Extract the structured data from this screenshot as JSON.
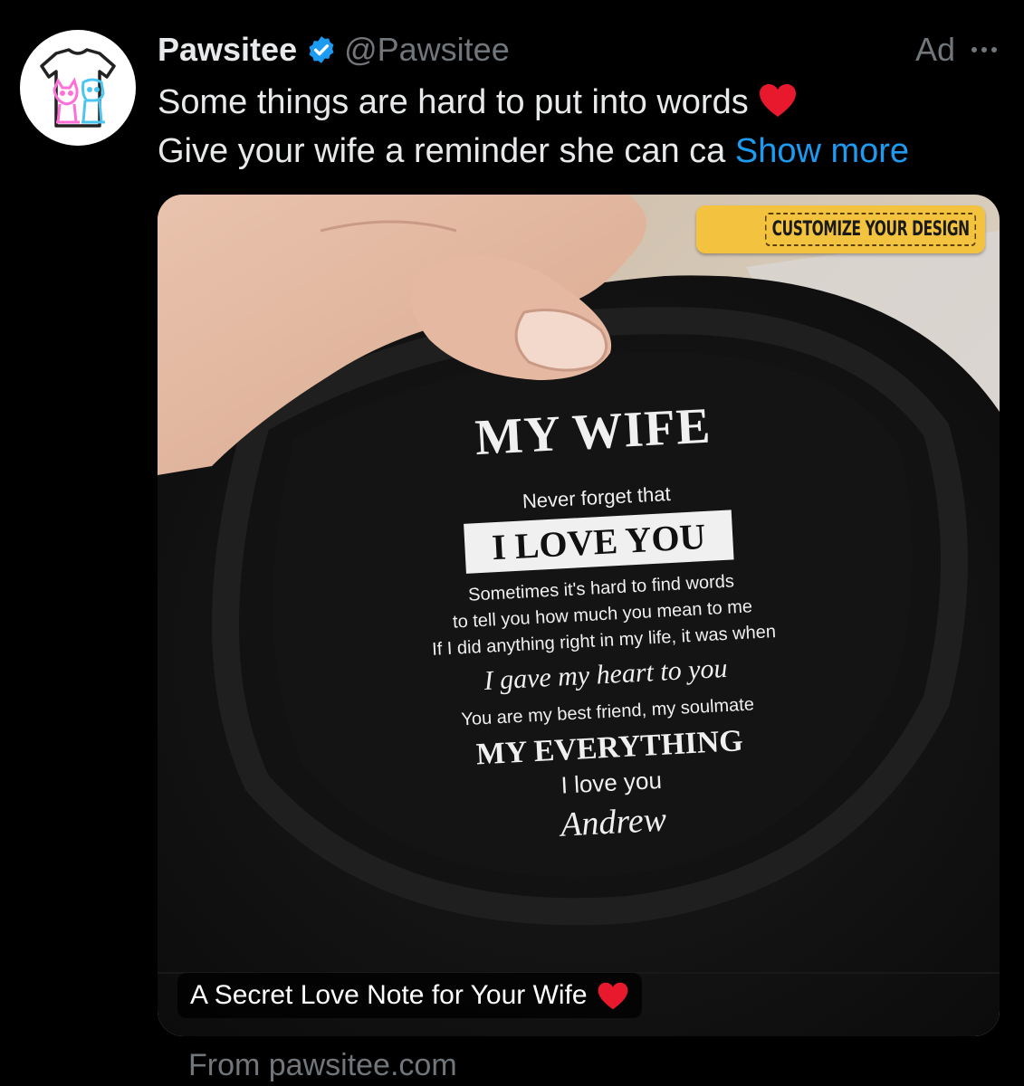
{
  "tweet": {
    "name": "Pawsitee",
    "handle": "@Pawsitee",
    "ad_label": "Ad",
    "line1": "Some things are hard to put into words",
    "line2": "Give your wife a reminder she can ca",
    "show_more": "Show more"
  },
  "media": {
    "badge": "CUSTOMIZE YOUR DESIGN",
    "caption": "A Secret Love Note for Your Wife",
    "print": {
      "title": "MY WIFE",
      "sub": "Never forget that",
      "banner": "I LOVE YOU",
      "body1": "Sometimes it's hard to find words",
      "body2": "to tell you how much you mean to me",
      "body3": "If I did anything right in my life, it was when",
      "script": "I gave my heart to you",
      "body4": "You are my best friend, my soulmate",
      "everything": "MY EVERYTHING",
      "love": "I love you",
      "signature": "Andrew"
    }
  },
  "source": "From pawsitee.com",
  "colors": {
    "background": "#000000",
    "text": "#e7e9ea",
    "muted": "#71767b",
    "link": "#1d9bf0",
    "badge": "#f3c23f",
    "heart": "#e8192c"
  }
}
